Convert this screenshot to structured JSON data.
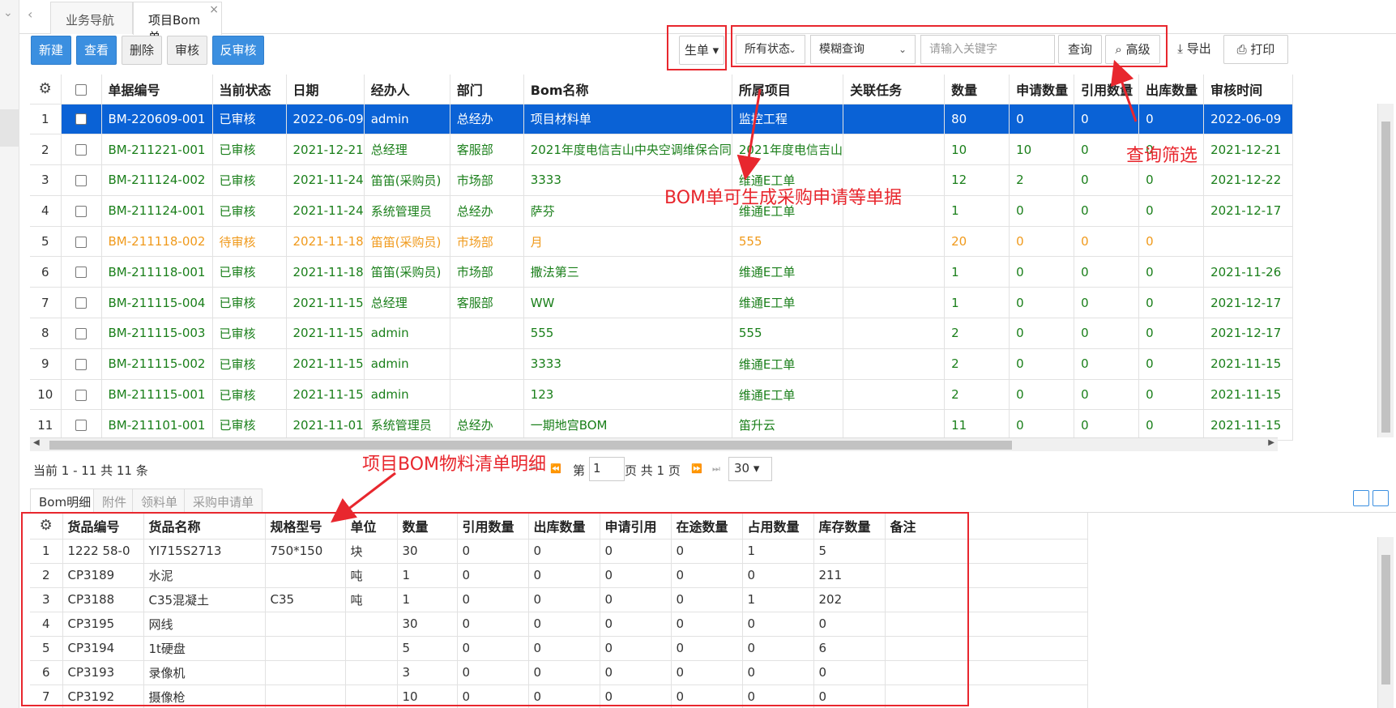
{
  "tabs": [
    {
      "label": "业务导航"
    },
    {
      "label": "项目Bom单",
      "close": "×"
    }
  ],
  "toolbar": {
    "new": "新建",
    "view": "查看",
    "delete": "删除",
    "audit": "审核",
    "unaudit": "反审核",
    "generate": "生单 ▾",
    "status_select": "所有状态",
    "mode_select": "模糊查询",
    "keyword_placeholder": "请输入关键字",
    "query": "查询",
    "advanced": "高级",
    "export": "导出",
    "print": "打印"
  },
  "annotations": {
    "generate": "BOM单可生成采购申请等单据",
    "filter": "查询筛选",
    "detail": "项目BOM物料清单明细"
  },
  "main_grid": {
    "columns": [
      "单据编号",
      "当前状态",
      "日期",
      "经办人",
      "部门",
      "Bom名称",
      "所属项目",
      "关联任务",
      "数量",
      "申请数量",
      "引用数量",
      "出库数量",
      "审核时间"
    ],
    "rows": [
      {
        "n": "1",
        "style": "selected",
        "cells": [
          "BM-220609-001",
          "已审核",
          "2022-06-09",
          "admin",
          "总经办",
          "项目材料单",
          "监控工程",
          "",
          "80",
          "0",
          "0",
          "0",
          "2022-06-09"
        ]
      },
      {
        "n": "2",
        "style": "green",
        "cells": [
          "BM-211221-001",
          "已审核",
          "2021-12-21",
          "总经理",
          "客服部",
          "2021年度电信吉山中央空调维保合同",
          "2021年度电信吉山",
          "",
          "10",
          "10",
          "0",
          "0",
          "2021-12-21"
        ]
      },
      {
        "n": "3",
        "style": "green",
        "cells": [
          "BM-211124-002",
          "已审核",
          "2021-11-24",
          "笛笛(采购员)",
          "市场部",
          "3333",
          "维通E工单",
          "",
          "12",
          "2",
          "0",
          "0",
          "2021-12-22"
        ]
      },
      {
        "n": "4",
        "style": "green",
        "cells": [
          "BM-211124-001",
          "已审核",
          "2021-11-24",
          "系统管理员",
          "总经办",
          "萨芬",
          "维通E工单",
          "",
          "1",
          "0",
          "0",
          "0",
          "2021-12-17"
        ]
      },
      {
        "n": "5",
        "style": "orange",
        "cells": [
          "BM-211118-002",
          "待审核",
          "2021-11-18",
          "笛笛(采购员)",
          "市场部",
          "月",
          "555",
          "",
          "20",
          "0",
          "0",
          "0",
          ""
        ]
      },
      {
        "n": "6",
        "style": "green",
        "cells": [
          "BM-211118-001",
          "已审核",
          "2021-11-18",
          "笛笛(采购员)",
          "市场部",
          "撒法第三",
          "维通E工单",
          "",
          "1",
          "0",
          "0",
          "0",
          "2021-11-26"
        ]
      },
      {
        "n": "7",
        "style": "green",
        "cells": [
          "BM-211115-004",
          "已审核",
          "2021-11-15",
          "总经理",
          "客服部",
          "WW",
          "维通E工单",
          "",
          "1",
          "0",
          "0",
          "0",
          "2021-12-17"
        ]
      },
      {
        "n": "8",
        "style": "green",
        "cells": [
          "BM-211115-003",
          "已审核",
          "2021-11-15",
          "admin",
          "",
          "555",
          "555",
          "",
          "2",
          "0",
          "0",
          "0",
          "2021-12-17"
        ]
      },
      {
        "n": "9",
        "style": "green",
        "cells": [
          "BM-211115-002",
          "已审核",
          "2021-11-15",
          "admin",
          "",
          "3333",
          "维通E工单",
          "",
          "2",
          "0",
          "0",
          "0",
          "2021-11-15"
        ]
      },
      {
        "n": "10",
        "style": "green",
        "cells": [
          "BM-211115-001",
          "已审核",
          "2021-11-15",
          "admin",
          "",
          "123",
          "维通E工单",
          "",
          "2",
          "0",
          "0",
          "0",
          "2021-11-15"
        ]
      },
      {
        "n": "11",
        "style": "green",
        "cells": [
          "BM-211101-001",
          "已审核",
          "2021-11-01",
          "系统管理员",
          "总经办",
          "一期地宫BOM",
          "笛升云",
          "",
          "11",
          "0",
          "0",
          "0",
          "2021-11-15"
        ]
      }
    ]
  },
  "pager": {
    "info": "当前 1 - 11 共 11 条",
    "page_label": "第",
    "page_value": "1",
    "page_total": "页 共 1 页",
    "page_size": "30 ▾"
  },
  "detail_tabs": [
    "Bom明细",
    "附件",
    "领料单",
    "采购申请单"
  ],
  "detail_grid": {
    "columns": [
      "货品编号",
      "货品名称",
      "规格型号",
      "单位",
      "数量",
      "引用数量",
      "出库数量",
      "申请引用",
      "在途数量",
      "占用数量",
      "库存数量",
      "备注"
    ],
    "rows": [
      {
        "n": "1",
        "cells": [
          "1222 58-0",
          "YI715S2713",
          "750*150",
          "块",
          "30",
          "0",
          "0",
          "0",
          "0",
          "1",
          "5",
          ""
        ]
      },
      {
        "n": "2",
        "cells": [
          "CP3189",
          "水泥",
          "",
          "吨",
          "1",
          "0",
          "0",
          "0",
          "0",
          "0",
          "211",
          ""
        ]
      },
      {
        "n": "3",
        "cells": [
          "CP3188",
          "C35混凝土",
          "C35",
          "吨",
          "1",
          "0",
          "0",
          "0",
          "0",
          "1",
          "202",
          ""
        ]
      },
      {
        "n": "4",
        "cells": [
          "CP3195",
          "网线",
          "",
          "",
          "30",
          "0",
          "0",
          "0",
          "0",
          "0",
          "0",
          ""
        ]
      },
      {
        "n": "5",
        "cells": [
          "CP3194",
          "1t硬盘",
          "",
          "",
          "5",
          "0",
          "0",
          "0",
          "0",
          "0",
          "6",
          ""
        ]
      },
      {
        "n": "6",
        "cells": [
          "CP3193",
          "录像机",
          "",
          "",
          "3",
          "0",
          "0",
          "0",
          "0",
          "0",
          "0",
          ""
        ]
      },
      {
        "n": "7",
        "cells": [
          "CP3192",
          "摄像枪",
          "",
          "",
          "10",
          "0",
          "0",
          "0",
          "0",
          "0",
          "0",
          ""
        ]
      }
    ]
  },
  "colors": {
    "accent": "#3b8fe0",
    "selected_row": "#0a62d6",
    "approved": "#1a7f1a",
    "pending": "#f09a1c",
    "annotation": "#e8272e"
  }
}
